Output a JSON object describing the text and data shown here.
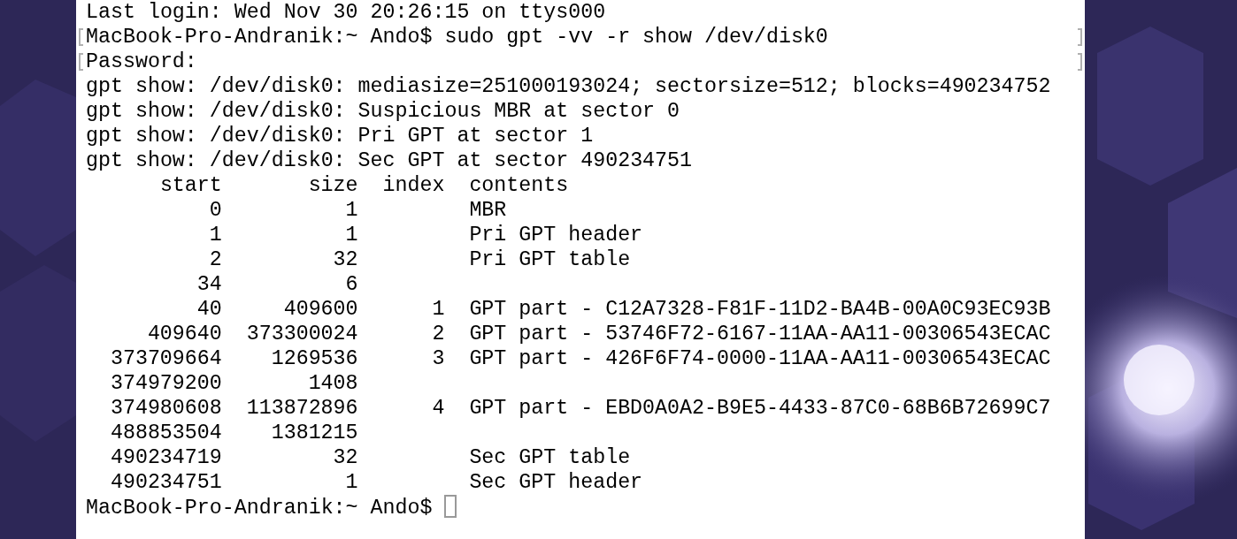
{
  "terminal": {
    "lines_before": [
      {
        "text": "Last login: Wed Nov 30 20:26:15 on ttys000",
        "marked": false
      },
      {
        "text": "MacBook-Pro-Andranik:~ Ando$ sudo gpt -vv -r show /dev/disk0",
        "marked": true
      },
      {
        "text": "Password:",
        "marked": true
      },
      {
        "text": "gpt show: /dev/disk0: mediasize=251000193024; sectorsize=512; blocks=490234752",
        "marked": false
      },
      {
        "text": "gpt show: /dev/disk0: Suspicious MBR at sector 0",
        "marked": false
      },
      {
        "text": "gpt show: /dev/disk0: Pri GPT at sector 1",
        "marked": false
      },
      {
        "text": "gpt show: /dev/disk0: Sec GPT at sector 490234751",
        "marked": false
      }
    ],
    "table": {
      "columns": [
        "start",
        "size",
        "index",
        "contents"
      ],
      "rows": [
        {
          "start": "0",
          "size": "1",
          "contents": "MBR"
        },
        {
          "start": "1",
          "size": "1",
          "contents": "Pri GPT header"
        },
        {
          "start": "2",
          "size": "32",
          "contents": "Pri GPT table"
        },
        {
          "start": "34",
          "size": "6"
        },
        {
          "start": "40",
          "size": "409600",
          "index": "1",
          "contents": "GPT part - C12A7328-F81F-11D2-BA4B-00A0C93EC93B"
        },
        {
          "start": "409640",
          "size": "373300024",
          "index": "2",
          "contents": "GPT part - 53746F72-6167-11AA-AA11-00306543ECAC"
        },
        {
          "start": "373709664",
          "size": "1269536",
          "index": "3",
          "contents": "GPT part - 426F6F74-0000-11AA-AA11-00306543ECAC"
        },
        {
          "start": "374979200",
          "size": "1408"
        },
        {
          "start": "374980608",
          "size": "113872896",
          "index": "4",
          "contents": "GPT part - EBD0A0A2-B9E5-4433-87C0-68B6B72699C7"
        },
        {
          "start": "488853504",
          "size": "1381215"
        },
        {
          "start": "490234719",
          "size": "32",
          "contents": "Sec GPT table"
        },
        {
          "start": "490234751",
          "size": "1",
          "contents": "Sec GPT header"
        }
      ]
    },
    "prompt": "MacBook-Pro-Andranik:~ Ando$"
  }
}
